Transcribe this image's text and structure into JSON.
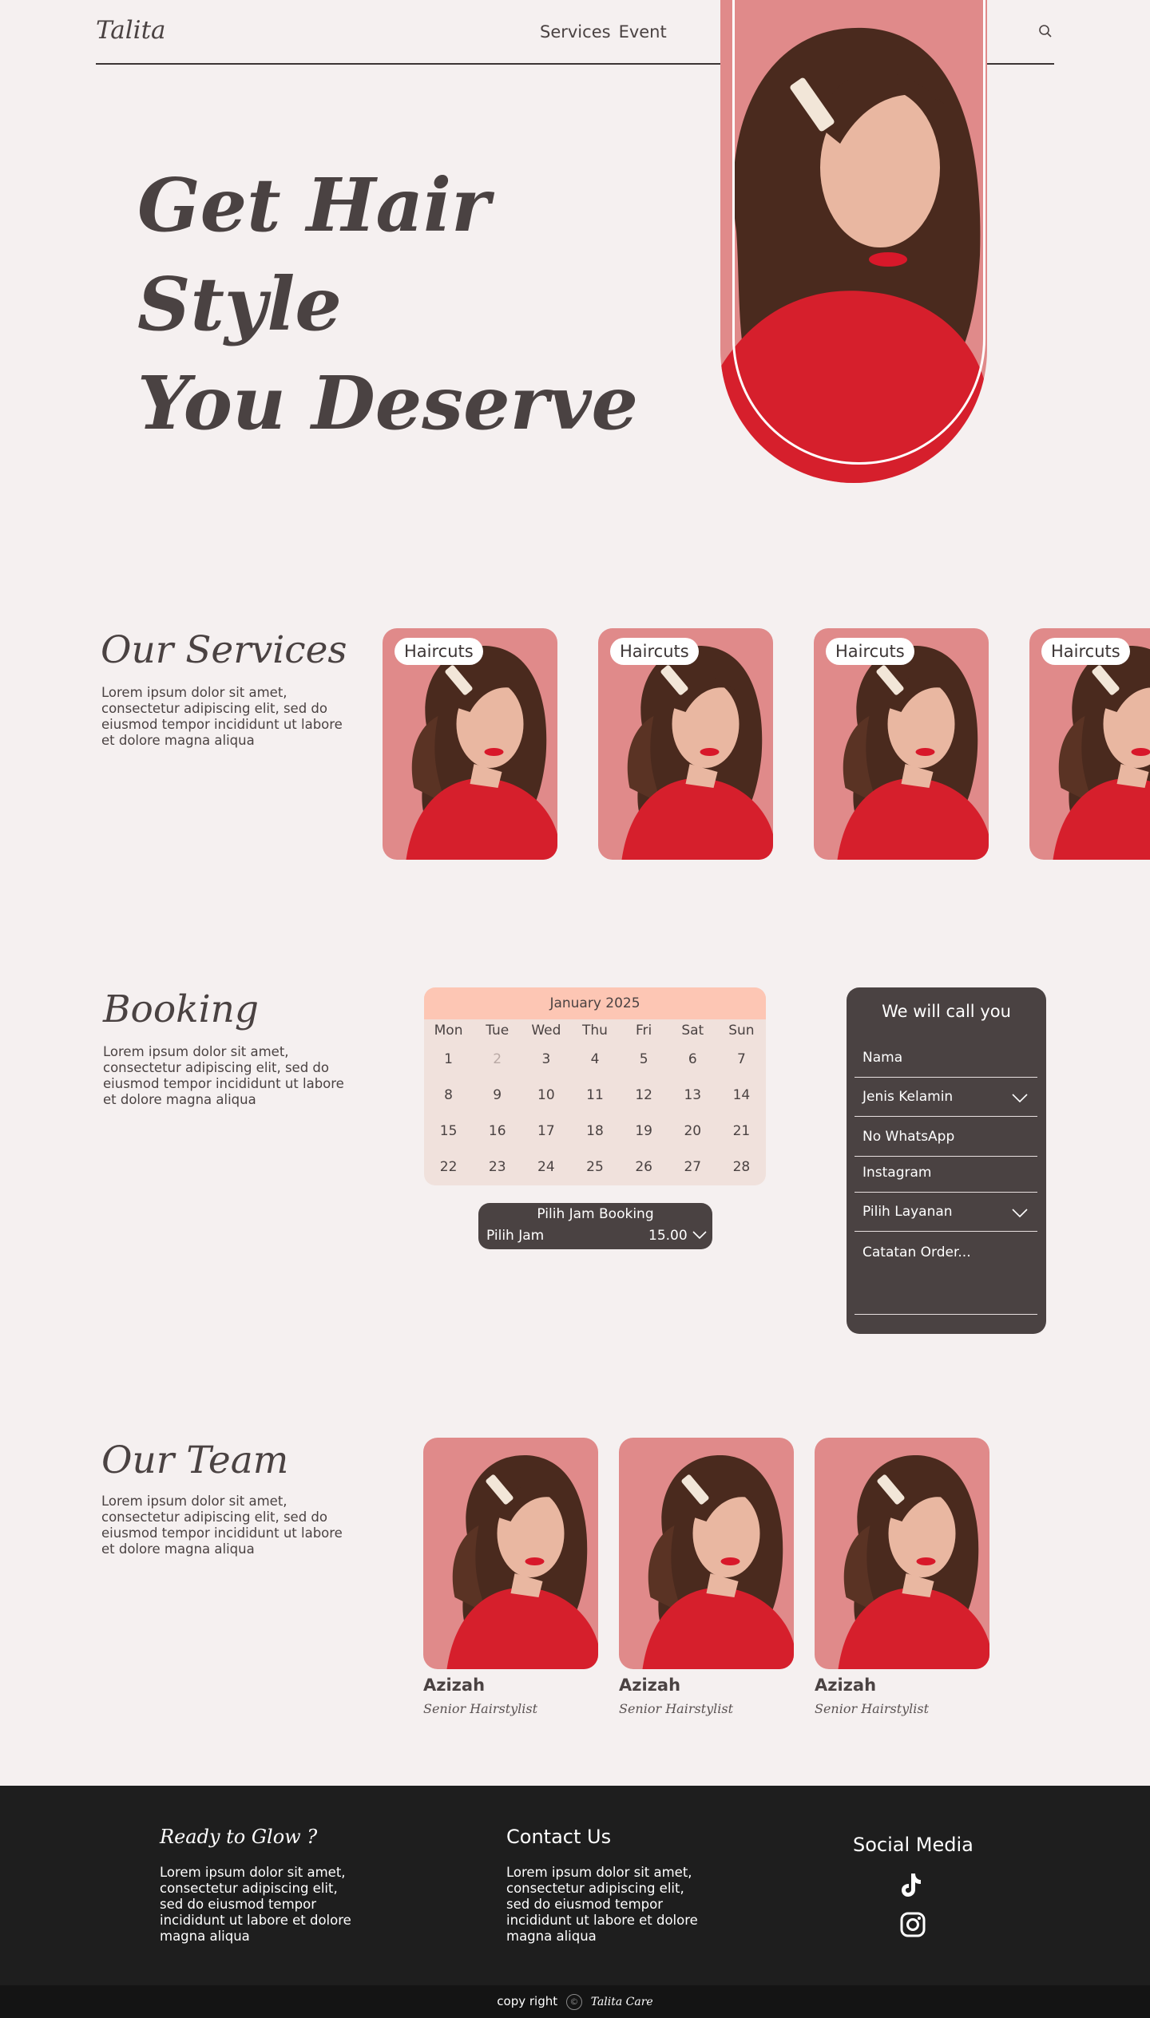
{
  "header": {
    "logo": "Talita",
    "nav": [
      "Services",
      "Event"
    ]
  },
  "hero": {
    "title_line1": "Get Hair Style",
    "title_line2": "You Deserve"
  },
  "services": {
    "title": "Our Services",
    "desc": "Lorem ipsum dolor sit amet, consectetur adipiscing elit, sed do eiusmod tempor incididunt ut labore et dolore magna aliqua",
    "cards": [
      {
        "label": "Haircuts"
      },
      {
        "label": "Haircuts"
      },
      {
        "label": "Haircuts"
      },
      {
        "label": "Haircuts"
      }
    ]
  },
  "booking": {
    "title": "Booking",
    "desc": "Lorem ipsum dolor sit amet, consectetur adipiscing elit, sed do eiusmod tempor incididunt ut labore et dolore magna aliqua",
    "calendar": {
      "month": "January 2025",
      "weekdays": [
        "Mon",
        "Tue",
        "Wed",
        "Thu",
        "Fri",
        "Sat",
        "Sun"
      ],
      "days": [
        "1",
        "2",
        "3",
        "4",
        "5",
        "6",
        "7",
        "8",
        "9",
        "10",
        "11",
        "12",
        "13",
        "14",
        "15",
        "16",
        "17",
        "18",
        "19",
        "20",
        "21",
        "22",
        "23",
        "24",
        "25",
        "26",
        "27",
        "28"
      ],
      "muted_day": "2"
    },
    "time": {
      "title": "Pilih Jam Booking",
      "label": "Pilih Jam",
      "value": "15.00"
    },
    "form": {
      "title": "We will call you",
      "name": "Nama",
      "gender": "Jenis Kelamin",
      "whatsapp": "No WhatsApp",
      "instagram": "Instagram",
      "service": "Pilih Layanan",
      "notes": "Catatan Order..."
    }
  },
  "team": {
    "title": "Our Team",
    "desc": "Lorem ipsum dolor sit amet, consectetur adipiscing elit, sed do eiusmod tempor incididunt ut labore et dolore magna aliqua",
    "members": [
      {
        "name": "Azizah",
        "role": "Senior Hairstylist"
      },
      {
        "name": "Azizah",
        "role": "Senior Hairstylist"
      },
      {
        "name": "Azizah",
        "role": "Senior Hairstylist"
      }
    ]
  },
  "footer": {
    "col1_title": "Ready to Glow ?",
    "col1_text": "Lorem ipsum dolor sit amet, consectetur adipiscing elit, sed do eiusmod tempor incididunt ut labore et dolore magna aliqua",
    "col2_title": "Contact Us",
    "col2_text": "Lorem ipsum dolor sit amet, consectetur adipiscing elit, sed do eiusmod tempor incididunt ut labore et dolore magna aliqua",
    "col3_title": "Social Media",
    "social_icons": [
      "tiktok-icon",
      "instagram-icon"
    ],
    "copyright_label": "copy right",
    "copyright_brand": "Talita Care"
  },
  "colors": {
    "background": "#f5f0f0",
    "text": "#4a4242",
    "pink": "#e08a8a",
    "peach": "#fdc6b4",
    "dark": "#1e1e1e"
  }
}
